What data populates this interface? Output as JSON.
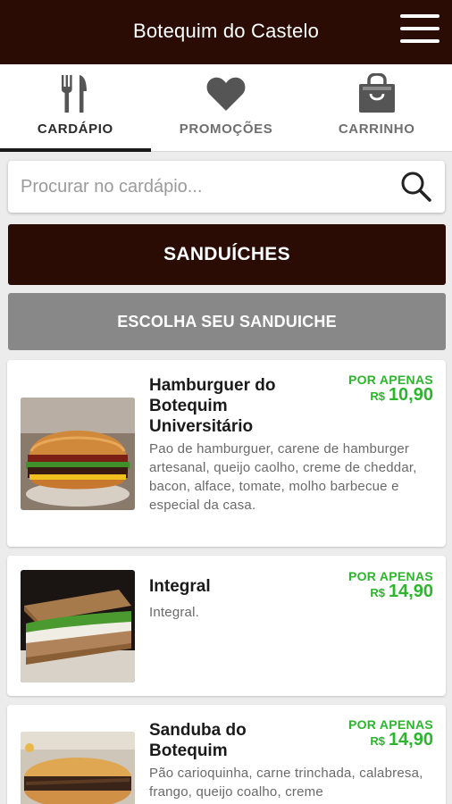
{
  "app": {
    "title": "Botequim do Castelo"
  },
  "tabs": [
    {
      "label": "CARDÁPIO",
      "icon": "fork-knife-icon",
      "active": true
    },
    {
      "label": "PROMOÇÕES",
      "icon": "heart-icon",
      "active": false
    },
    {
      "label": "CARRINHO",
      "icon": "shopping-bag-icon",
      "active": false
    }
  ],
  "search": {
    "placeholder": "Procurar no cardápio..."
  },
  "category": {
    "label": "SANDUÍCHES"
  },
  "subcategory": {
    "label": "ESCOLHA SEU SANDUICHE"
  },
  "products": [
    {
      "name": "Hamburguer do Botequim Universitário",
      "description": "Pao de hamburguer, carene de hamburger artesanal, queijo caolho, creme de cheddar, bacon, alface, tomate, molho barbecue e especial da casa.",
      "price_prefix": "POR APENAS",
      "currency": "R$",
      "price": "10,90"
    },
    {
      "name": "Integral",
      "description": "Integral.",
      "price_prefix": "POR APENAS",
      "currency": "R$",
      "price": "14,90"
    },
    {
      "name": "Sanduba do Botequim",
      "description": "Pão carioquinha, carne trinchada, calabresa, frango, queijo coalho, creme",
      "price_prefix": "POR APENAS",
      "currency": "R$",
      "price": "14,90"
    }
  ],
  "colors": {
    "brand": "#2a0c05",
    "price": "#2db52d",
    "sub_button": "#888888"
  }
}
